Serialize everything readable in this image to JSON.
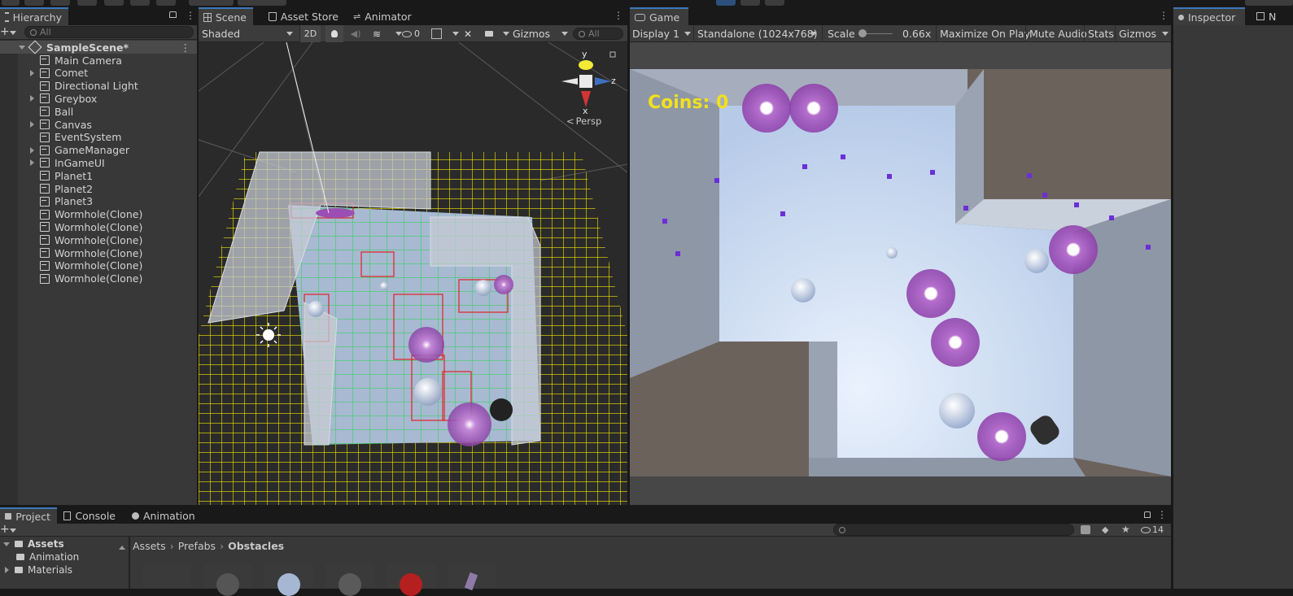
{
  "hierarchy": {
    "tab_label": "Hierarchy",
    "search_placeholder": "All",
    "scene_name": "SampleScene*",
    "items": [
      {
        "label": "Main Camera",
        "expandable": false
      },
      {
        "label": "Comet",
        "expandable": true
      },
      {
        "label": "Directional Light",
        "expandable": false
      },
      {
        "label": "Greybox",
        "expandable": true
      },
      {
        "label": "Ball",
        "expandable": false
      },
      {
        "label": "Canvas",
        "expandable": true
      },
      {
        "label": "EventSystem",
        "expandable": false
      },
      {
        "label": "GameManager",
        "expandable": true
      },
      {
        "label": "InGameUI",
        "expandable": true
      },
      {
        "label": "Planet1",
        "expandable": false
      },
      {
        "label": "Planet2",
        "expandable": false
      },
      {
        "label": "Planet3",
        "expandable": false
      },
      {
        "label": "Wormhole(Clone)",
        "expandable": false
      },
      {
        "label": "Wormhole(Clone)",
        "expandable": false
      },
      {
        "label": "Wormhole(Clone)",
        "expandable": false
      },
      {
        "label": "Wormhole(Clone)",
        "expandable": false
      },
      {
        "label": "Wormhole(Clone)",
        "expandable": false
      },
      {
        "label": "Wormhole(Clone)",
        "expandable": false
      }
    ]
  },
  "scene_view": {
    "tabs": {
      "scene": "Scene",
      "asset_store": "Asset Store",
      "animator": "Animator"
    },
    "shading_mode": "Shaded",
    "mode_2d": "2D",
    "hidden_count": "0",
    "gizmos": "Gizmos",
    "search_placeholder": "All",
    "axis_labels": {
      "y": "y",
      "z": "z",
      "x": "x"
    },
    "projection": "Persp"
  },
  "game_view": {
    "tab_label": "Game",
    "display": "Display 1",
    "resolution": "Standalone (1024x768)",
    "scale_label": "Scale",
    "scale_value": "0.66x",
    "maximize_on_play": "Maximize On Play",
    "mute_audio": "Mute Audio",
    "stats": "Stats",
    "gizmos": "Gizmos",
    "hud_coins": "Coins: 0"
  },
  "inspector": {
    "tab_label": "Inspector",
    "second_tab_label": "N"
  },
  "project": {
    "tabs": {
      "project": "Project",
      "console": "Console",
      "animation": "Animation"
    },
    "tree_root": "Assets",
    "tree_items": [
      "Animation",
      "Materials"
    ],
    "breadcrumb": [
      "Assets",
      "Prefabs",
      "Obstacles"
    ],
    "hidden_count": "14"
  },
  "colors": {
    "accent": "#3a79bb",
    "hud_yellow": "#f1e11c",
    "grid_yellow": "#f2e600",
    "grid_green": "#21d64b",
    "grid_red": "#e02323",
    "wormhole_purple": "#9b4fb5"
  }
}
